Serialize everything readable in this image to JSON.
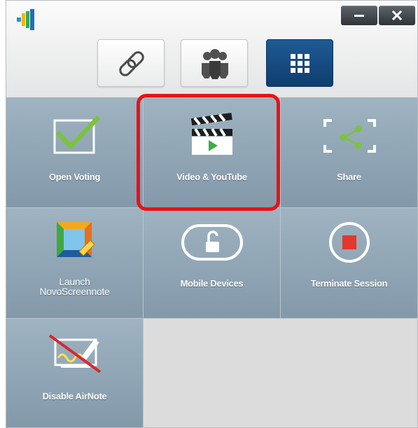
{
  "window": {
    "logo_icon": "novo-logo-icon",
    "minimize_icon": "minimize-icon",
    "close_icon": "close-icon"
  },
  "mode_buttons": [
    {
      "id": "link",
      "icon": "link-icon",
      "active": false
    },
    {
      "id": "participants",
      "icon": "users-group-icon",
      "active": false
    },
    {
      "id": "apps",
      "icon": "grid-icon",
      "active": true
    }
  ],
  "tiles": [
    {
      "label": "Open Voting",
      "icon": "checkbox-icon"
    },
    {
      "label": "Video & YouTube",
      "icon": "clapperboard-icon"
    },
    {
      "label": "Share",
      "icon": "share-icon"
    },
    {
      "label_line1": "Launch",
      "label_line2": "NovoScreennote",
      "icon": "screennote-icon"
    },
    {
      "label": "Mobile Devices",
      "icon": "unlock-icon"
    },
    {
      "label": "Terminate Session",
      "icon": "stop-icon"
    },
    {
      "label": "Disable AirNote",
      "icon": "airnote-disabled-icon"
    }
  ],
  "colors": {
    "active_button": "#1f5b95",
    "tile": "#8fa4b4",
    "highlight": "#e31418",
    "check_green": "#7cc242"
  }
}
